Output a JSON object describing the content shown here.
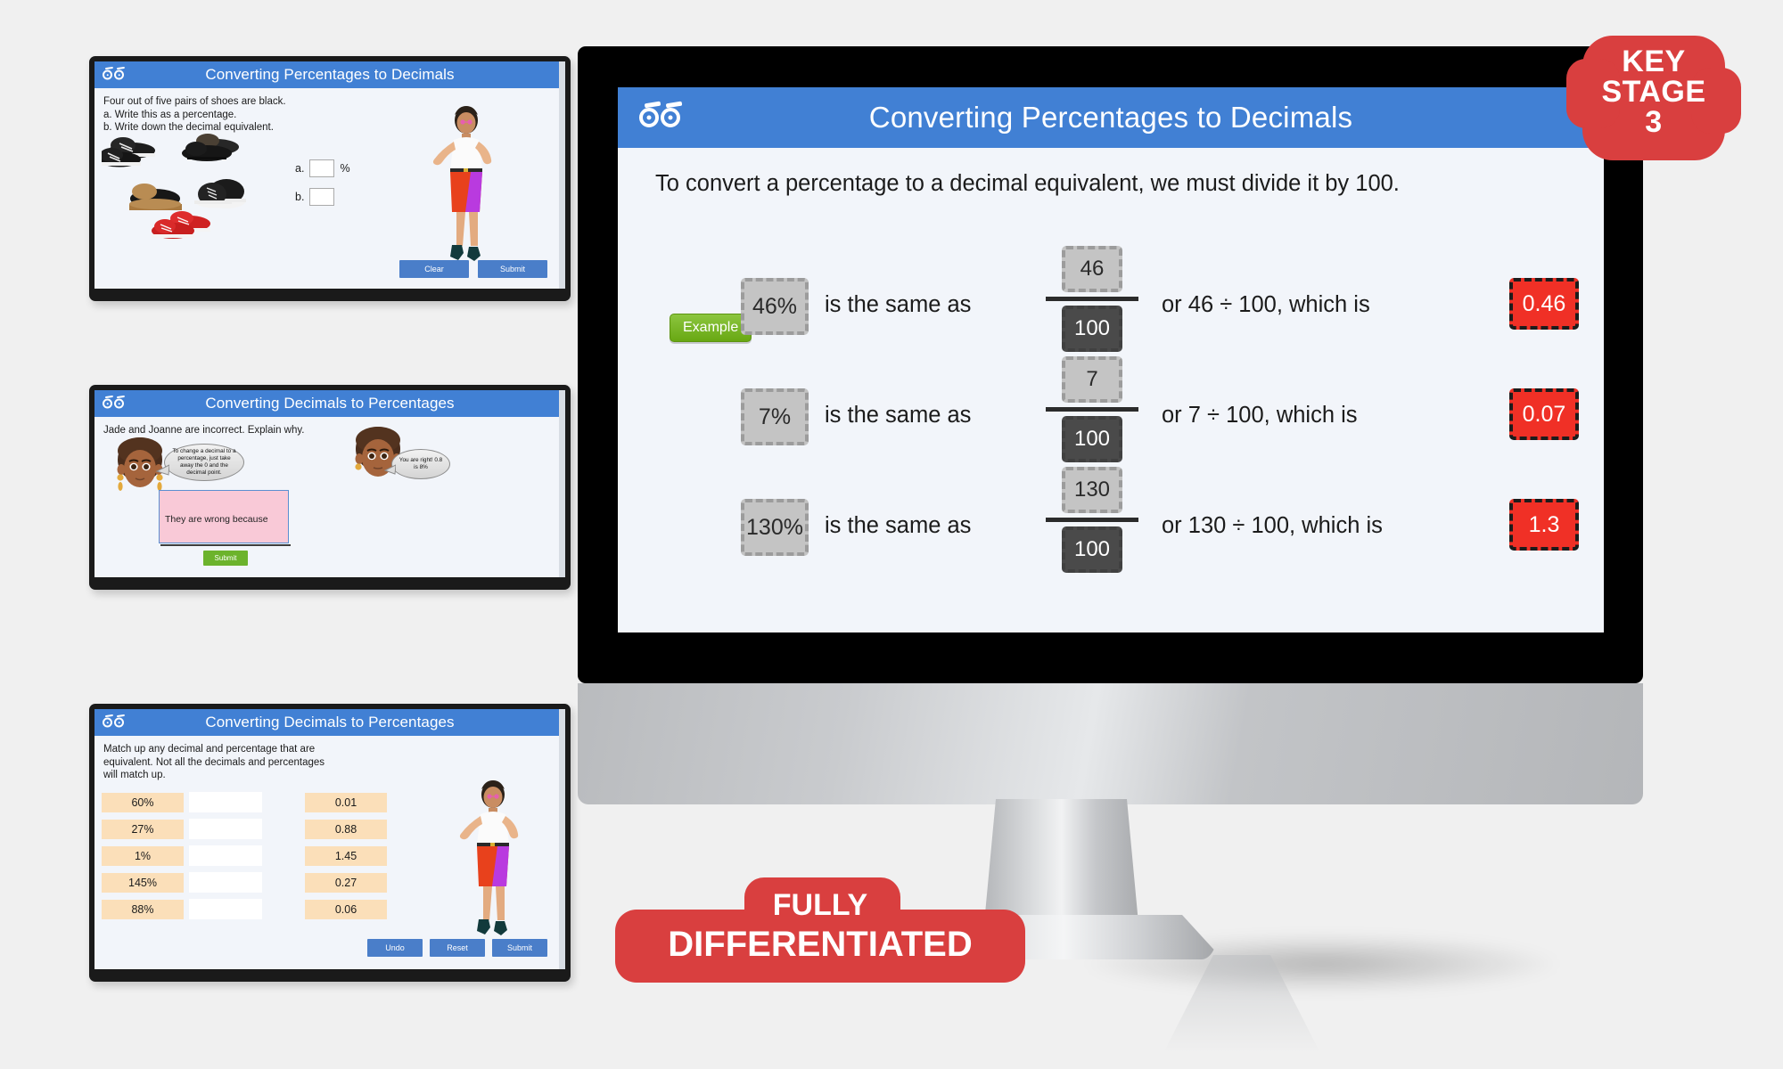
{
  "page": {
    "background_color": "#f0f0f0",
    "accent_blue": "#4180d4",
    "accent_red": "#d93f3f",
    "answer_red": "#f03026"
  },
  "badges": {
    "key_stage": {
      "line1": "KEY",
      "line2": "STAGE",
      "line3": "3"
    },
    "fully_differentiated": {
      "line1": "FULLY",
      "line2": "DIFFERENTIATED"
    }
  },
  "main_slide": {
    "header_title": "Converting Percentages to Decimals",
    "lead": "To convert a percentage to a decimal equivalent, we must divide it by 100.",
    "example_label": "Example",
    "rows": [
      {
        "percentage": "46%",
        "phrase": "is the same as",
        "numerator": "46",
        "denominator": "100",
        "tail": "or 46 ÷ 100, which is",
        "result": "0.46"
      },
      {
        "percentage": "7%",
        "phrase": "is the same as",
        "numerator": "7",
        "denominator": "100",
        "tail": "or 7 ÷ 100, which is",
        "result": "0.07"
      },
      {
        "percentage": "130%",
        "phrase": "is the same as",
        "numerator": "130",
        "denominator": "100",
        "tail": "or 130 ÷ 100, which is",
        "result": "1.3"
      }
    ]
  },
  "slide1": {
    "header_title": "Converting Percentages to Decimals",
    "question_line1": "Four out of five pairs of shoes are black.",
    "question_line2": "a.  Write this as a percentage.",
    "question_line3": "b.  Write down the decimal equivalent.",
    "answer_a_label": "a.",
    "answer_a_suffix": "%",
    "answer_a_value": "",
    "answer_b_label": "b.",
    "answer_b_value": "",
    "clear_label": "Clear",
    "submit_label": "Submit"
  },
  "slide2": {
    "header_title": "Converting Decimals to Percentages",
    "question": "Jade and Joanne are incorrect. Explain why.",
    "bubble_left": "To change a decimal to a percentage, just take away the 0 and the decimal point.",
    "bubble_right": "You are right! 0.8 is 8%",
    "answer_text": "They are wrong because",
    "submit_label": "Submit"
  },
  "slide3": {
    "header_title": "Converting Decimals to Percentages",
    "question_line1": "Match up any decimal and percentage that are",
    "question_line2": "equivalent. Not all the decimals and percentages",
    "question_line3": "will match up.",
    "percentages": [
      "60%",
      "27%",
      "1%",
      "145%",
      "88%"
    ],
    "drop_values": [
      "",
      "",
      "",
      "",
      ""
    ],
    "decimals": [
      "0.01",
      "0.88",
      "1.45",
      "0.27",
      "0.06"
    ],
    "undo_label": "Undo",
    "reset_label": "Reset",
    "submit_label": "Submit"
  }
}
